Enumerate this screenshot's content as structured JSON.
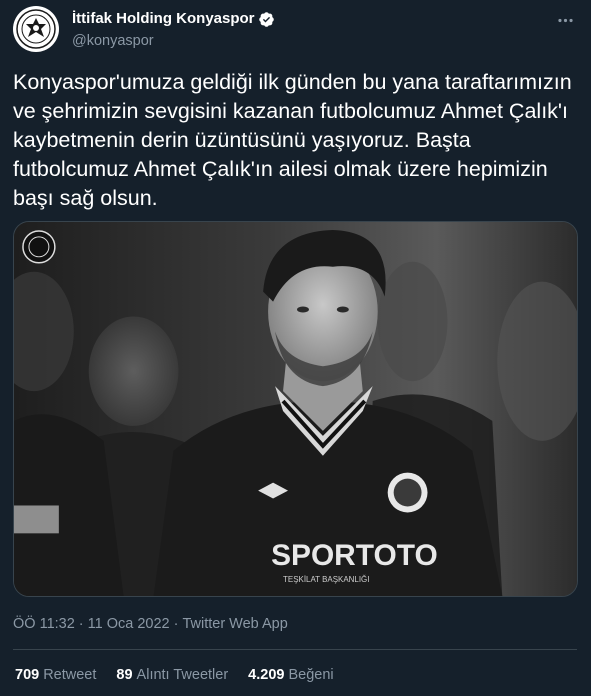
{
  "account": {
    "display_name": "İttifak Holding Konyaspor",
    "handle": "@konyaspor",
    "verified": true,
    "avatar_icon": "konyaspor-crest-icon"
  },
  "tweet": {
    "text": "Konyaspor'umuza geldiği ilk günden bu yana taraftarımızın ve şehrimizin sevgisini kazanan futbolcumuz Ahmet Çalık'ı kaybetmenin derin üzüntüsünü yaşıyoruz. Başta futbolcumuz Ahmet Çalık'ın ailesi olmak üzere hepimizin başı sağ olsun.",
    "media": {
      "jersey_brand": "SPORTOTO",
      "jersey_subtext": "TEŞKİLAT BAŞKANLIĞI"
    }
  },
  "meta": {
    "time": "ÖÖ 11:32",
    "date": "11 Oca 2022",
    "source": "Twitter Web App",
    "separator": "·"
  },
  "stats": {
    "retweets_count": "709",
    "retweets_label": "Retweet",
    "quotes_count": "89",
    "quotes_label": "Alıntı Tweetler",
    "likes_count": "4.209",
    "likes_label": "Beğeni"
  },
  "colors": {
    "background": "#15202b",
    "text_primary": "#ffffff",
    "text_secondary": "#8b98a5",
    "verified": "#ffffff",
    "divider": "#38444d"
  }
}
